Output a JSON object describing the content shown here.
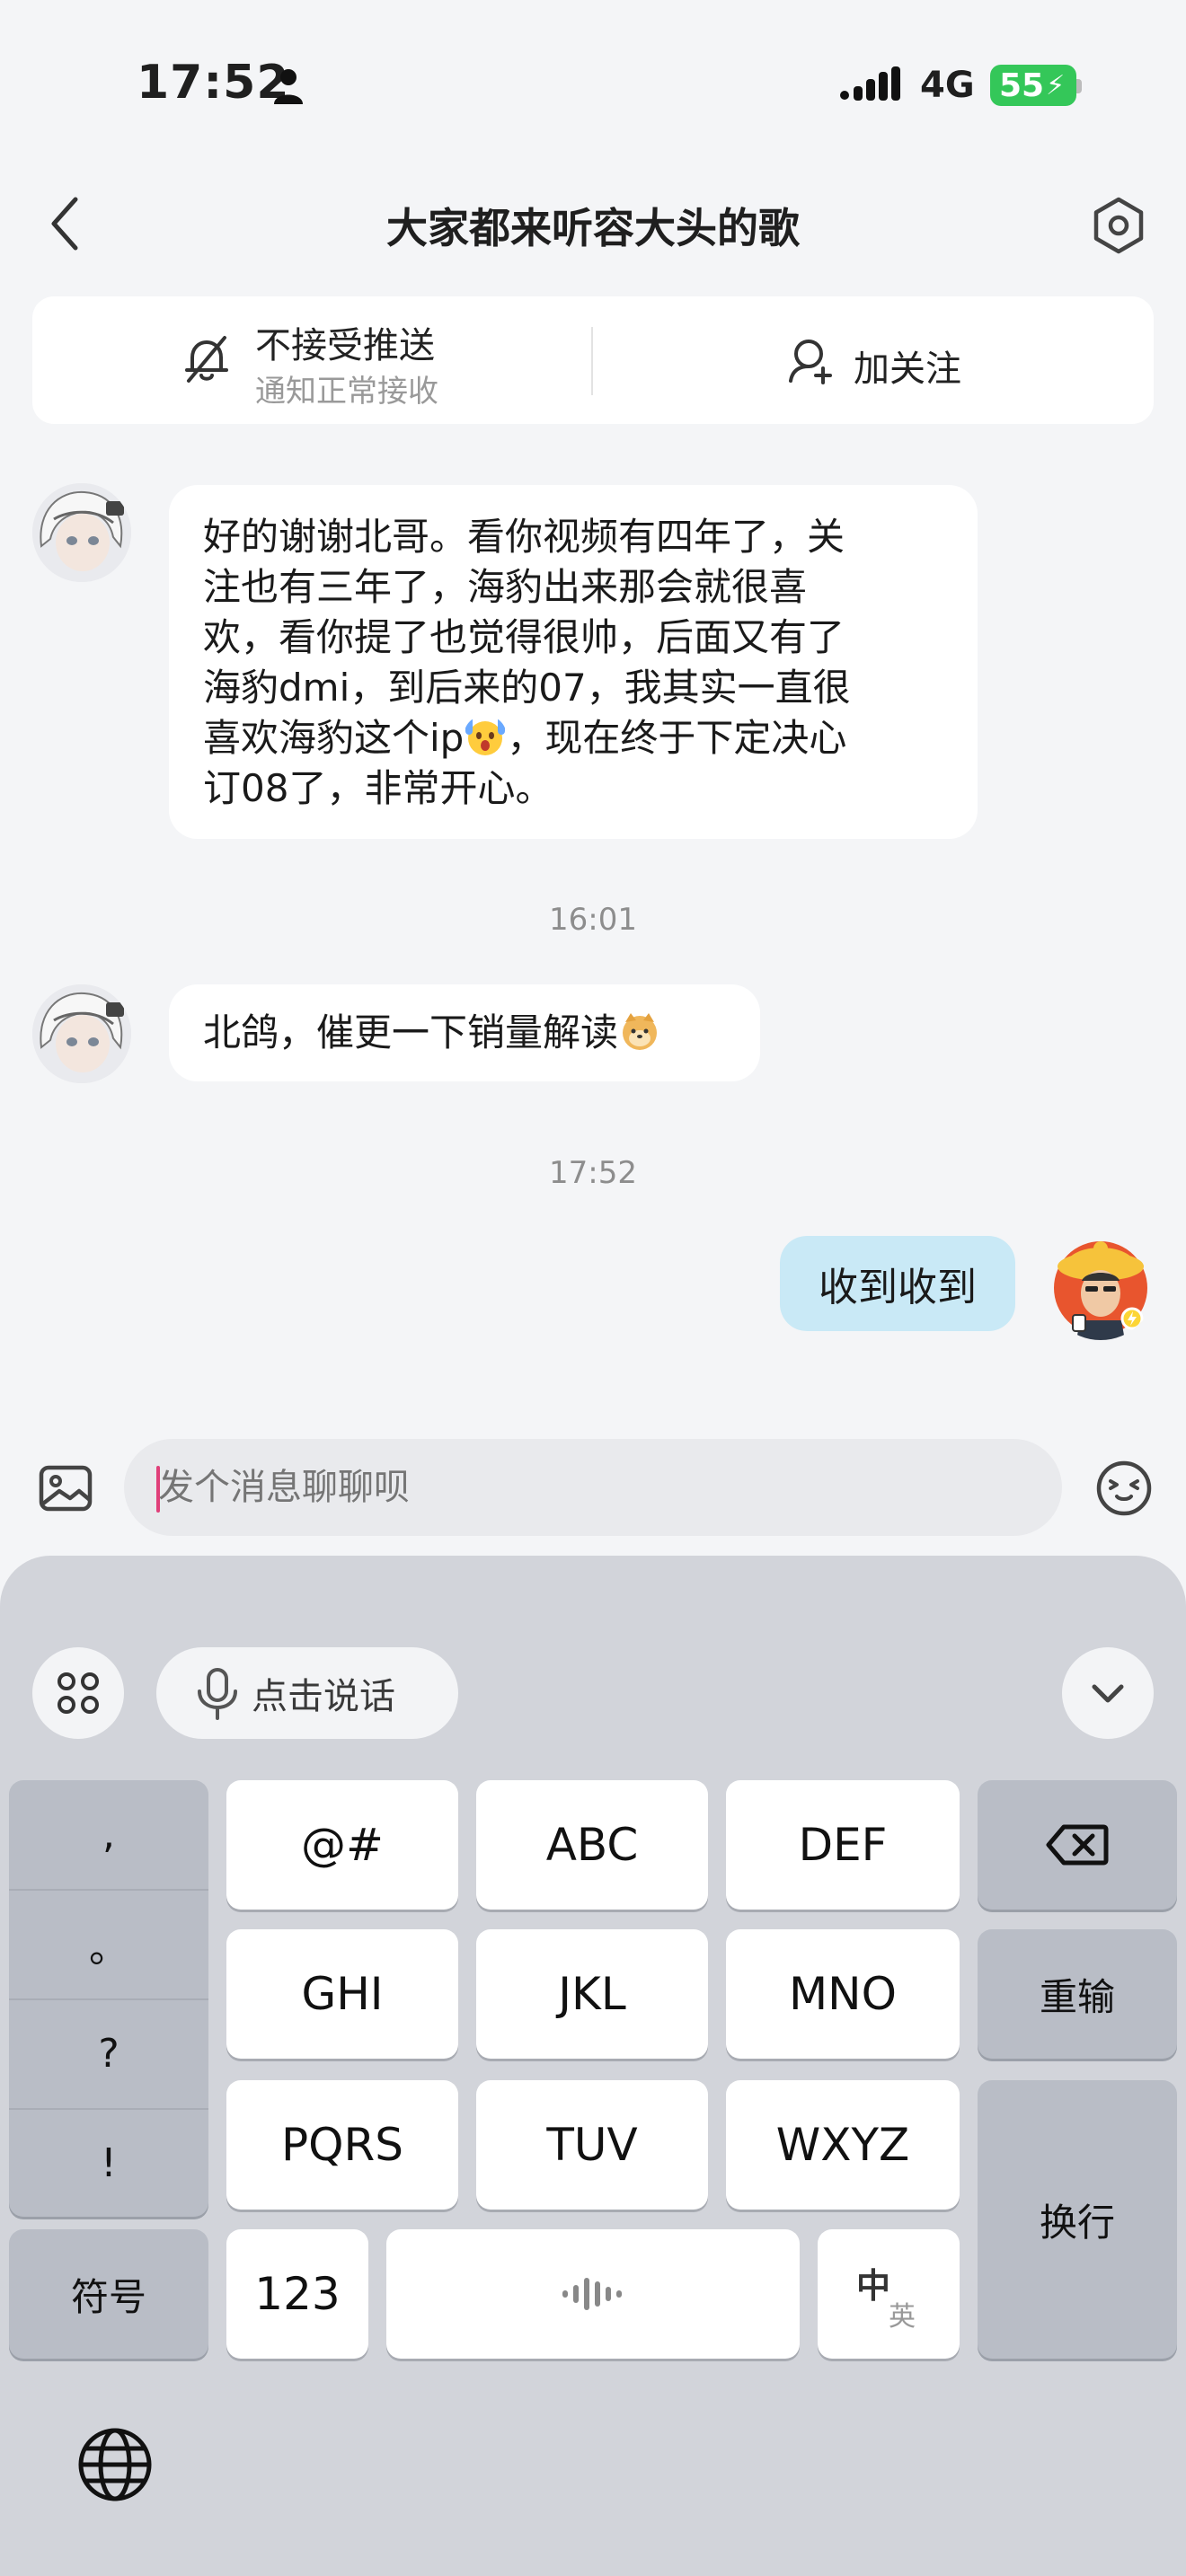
{
  "status_bar": {
    "time": "17:52",
    "network": "4G",
    "battery": "55"
  },
  "header": {
    "title": "大家都来听容大头的歌"
  },
  "actions": {
    "mute_title": "不接受推送",
    "mute_subtitle": "通知正常接收",
    "follow_label": "加关注"
  },
  "messages": [
    {
      "sender": "other",
      "lines": [
        "好的谢谢北哥。看你视频有四年了，关",
        "注也有三年了，海豹出来那会就很喜",
        "欢，看你提了也觉得很帅，后面又有了",
        "海豹dmi，到后来的07，我其实一直很",
        "喜欢海豹这个ip",
        "，现在终于下定决心",
        "订08了，非常开心。"
      ]
    },
    {
      "timestamp": "16:01"
    },
    {
      "sender": "other",
      "text": "北鸽，催更一下销量解读"
    },
    {
      "timestamp": "17:52"
    },
    {
      "sender": "self",
      "text": "收到收到"
    }
  ],
  "input": {
    "placeholder": "发个消息聊聊呗"
  },
  "keyboard": {
    "voice_label": "点击说话",
    "punctuation": [
      ",",
      "。",
      "?",
      "!"
    ],
    "symbol_key": "符号",
    "rows": [
      [
        "@#",
        "ABC",
        "DEF"
      ],
      [
        "GHI",
        "JKL",
        "MNO"
      ],
      [
        "PQRS",
        "TUV",
        "WXYZ"
      ]
    ],
    "reinput_key": "重输",
    "newline_key": "换行",
    "num_key": "123",
    "lang_key_top": "中",
    "lang_key_bottom": "英"
  },
  "colors": {
    "outgoing_bubble": "#c9e9f6",
    "incoming_bubble": "#ffffff",
    "battery": "#34c759",
    "caret": "#e0407a"
  }
}
